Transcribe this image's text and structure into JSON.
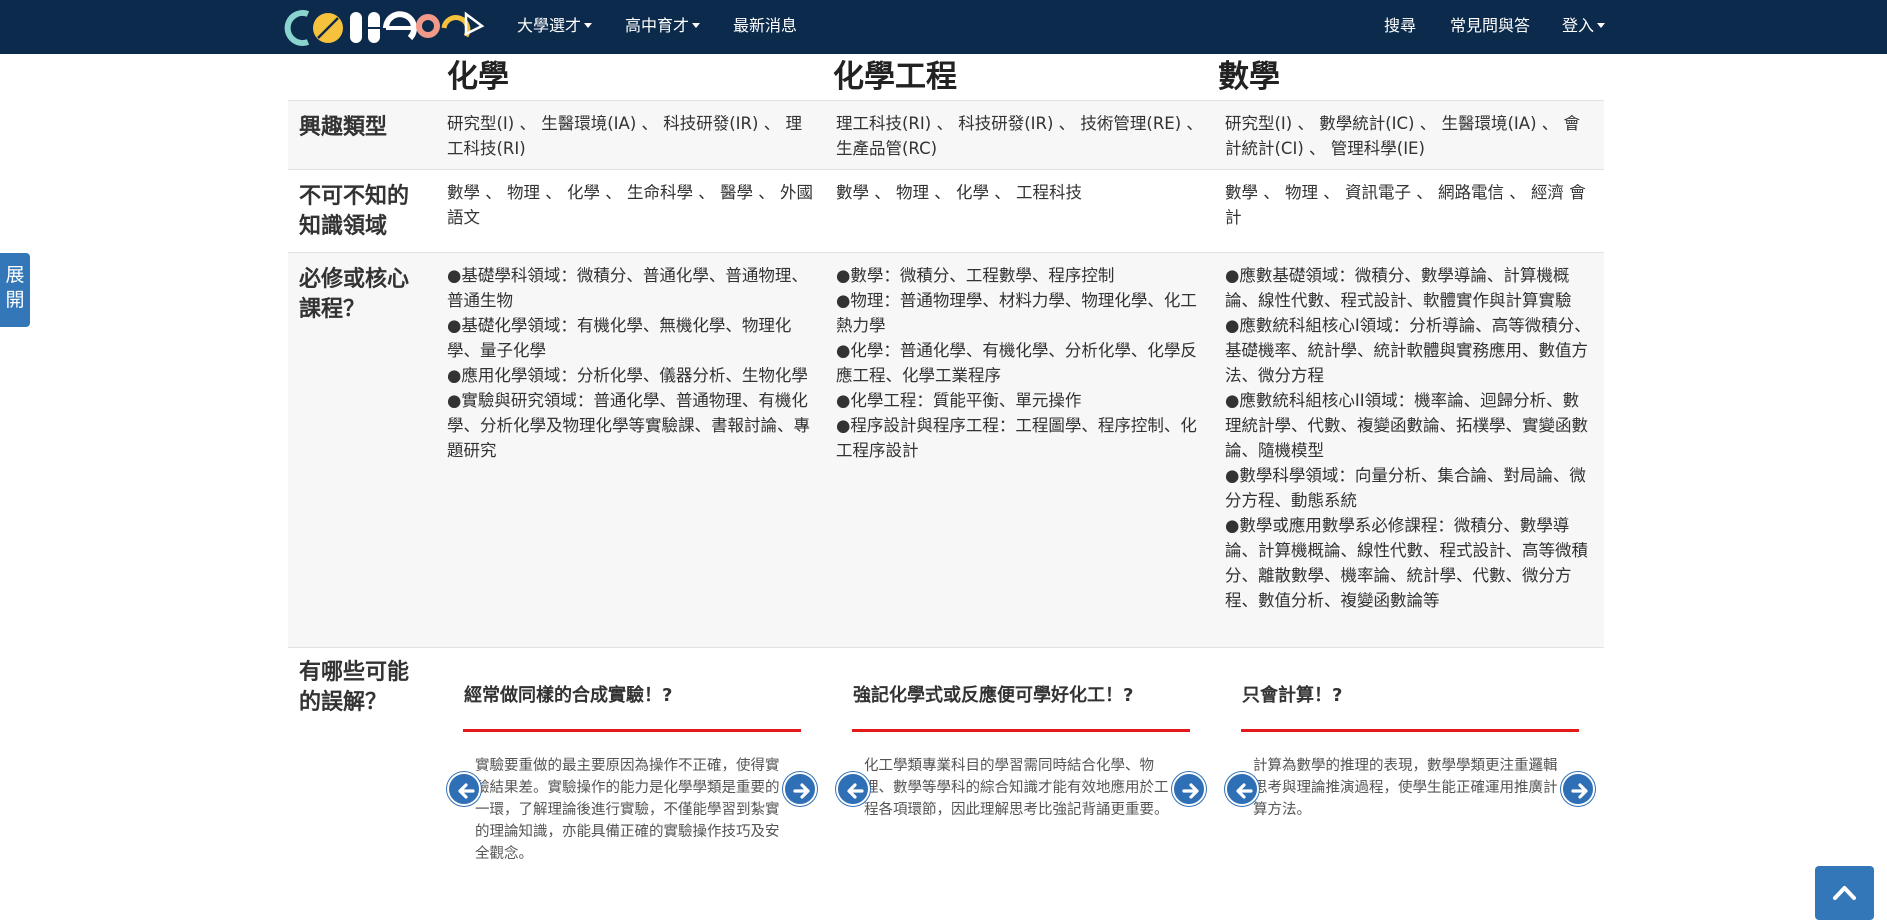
{
  "nav": {
    "brand": "college",
    "items": [
      {
        "label": "大學選才",
        "dropdown": true
      },
      {
        "label": "高中育才",
        "dropdown": true
      },
      {
        "label": "最新消息",
        "dropdown": false
      }
    ],
    "right_items": [
      {
        "label": "搜尋",
        "dropdown": false
      },
      {
        "label": "常見問與答",
        "dropdown": false
      },
      {
        "label": "登入",
        "dropdown": true
      }
    ]
  },
  "side_tab": {
    "line1": "展",
    "line2": "開"
  },
  "columns": [
    "化學",
    "化學工程",
    "數學"
  ],
  "rows": {
    "interest": {
      "label": "興趣類型",
      "cells": [
        "研究型(I) 、 生醫環境(IA) 、 科技研發(IR) 、 理工科技(RI)",
        "理工科技(RI) 、 科技研發(IR) 、 技術管理(RE) 、 生產品管(RC)",
        "研究型(I) 、 數學統計(IC) 、 生醫環境(IA) 、 會計統計(CI) 、 管理科學(IE)"
      ]
    },
    "knowledge": {
      "label": "不可不知的知識領域",
      "cells": [
        "數學 、 物理 、 化學 、 生命科學 、 醫學 、 外國語文",
        "數學 、 物理 、 化學 、 工程科技",
        "數學 、 物理 、 資訊電子 、 網路電信 、 經濟 會計"
      ]
    },
    "courses": {
      "label": "必修或核心課程？",
      "cells": [
        [
          "●基礎學科領域：微積分、普通化學、普通物理、普通生物",
          "●基礎化學領域：有機化學、無機化學、物理化學、量子化學",
          "●應用化學領域：分析化學、儀器分析、生物化學",
          "●實驗與研究領域：普通化學、普通物理、有機化學、分析化學及物理化學等實驗課、書報討論、專題研究"
        ],
        [
          "●數學：微積分、工程數學、程序控制",
          "●物理：普通物理學、材料力學、物理化學、化工熱力學",
          "●化學：普通化學、有機化學、分析化學、化學反應工程、化學工業程序",
          "●化學工程：質能平衡、單元操作",
          "●程序設計與程序工程：工程圖學、程序控制、化工程序設計"
        ],
        [
          "●應數基礎領域：微積分、數學導論、計算機概論、線性代數、程式設計、軟體實作與計算實驗",
          "●應數統科組核心I領域：分析導論、高等微積分、基礎機率、統計學、統計軟體與實務應用、數值方法、微分方程",
          "●應數統科組核心II領域：機率論、迴歸分析、數理統計學、代數、複變函數論、拓樸學、實變函數論、隨機模型",
          "●數學科學領域：向量分析、集合論、對局論、微分方程、動態系統",
          "●數學或應用數學系必修課程：微積分、數學導論、計算機概論、線性代數、程式設計、高等微積分、離散數學、機率論、統計學、代數、微分方程、數值分析、複變函數論等"
        ]
      ]
    },
    "misconceptions": {
      "label": "有哪些可能的誤解？",
      "cards": [
        {
          "title": "經常做同樣的合成實驗！?",
          "text": "實驗要重做的最主要原因為操作不正確，使得實驗結果差。實驗操作的能力是化學學類是重要的一環，了解理論後進行實驗，不僅能學習到紮實的理論知識，亦能具備正確的實驗操作技巧及安全觀念。"
        },
        {
          "title": "強記化學式或反應便可學好化工！?",
          "text": "化工學類專業科目的學習需同時結合化學、物理、數學等學科的綜合知識才能有效地應用於工程各項環節，因此理解思考比強記背誦更重要。"
        },
        {
          "title": "只會計算！?",
          "text": "計算為數學的推理的表現，數學學類更注重邏輯思考與理論推演過程，使學生能正確運用推廣計算方法。"
        }
      ]
    }
  },
  "colors": {
    "navbar": "#0c2a4b",
    "accent_blue": "#3377b8",
    "red_rule": "#e41919",
    "row_shade": "#f7f7f7"
  },
  "icons": [
    "logo-icon",
    "arrow-left-icon",
    "arrow-right-icon",
    "chevron-up-icon",
    "caret-down-icon"
  ]
}
